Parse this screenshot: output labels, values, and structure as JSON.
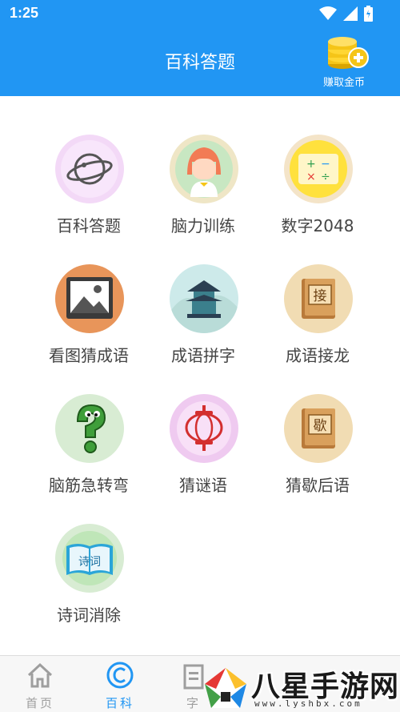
{
  "status": {
    "time": "1:25"
  },
  "header": {
    "title": "百科答题",
    "coin_label": "赚取金币"
  },
  "tiles": [
    {
      "label": "百科答题"
    },
    {
      "label": "脑力训练"
    },
    {
      "label": "数字2048"
    },
    {
      "label": "看图猜成语"
    },
    {
      "label": "成语拼字"
    },
    {
      "label": "成语接龙"
    },
    {
      "label": "脑筋急转弯"
    },
    {
      "label": "猜谜语"
    },
    {
      "label": "猜歇后语"
    },
    {
      "label": "诗词消除"
    }
  ],
  "tile_icon_text": {
    "jie": "接",
    "xie": "歇",
    "poem": "诗词"
  },
  "nav": [
    {
      "label": "首页"
    },
    {
      "label": "百科"
    },
    {
      "label": "字"
    }
  ],
  "watermark": {
    "text": "八星手游网",
    "url": "www.lyshbx.com"
  },
  "colors": {
    "primary": "#2196f3"
  }
}
